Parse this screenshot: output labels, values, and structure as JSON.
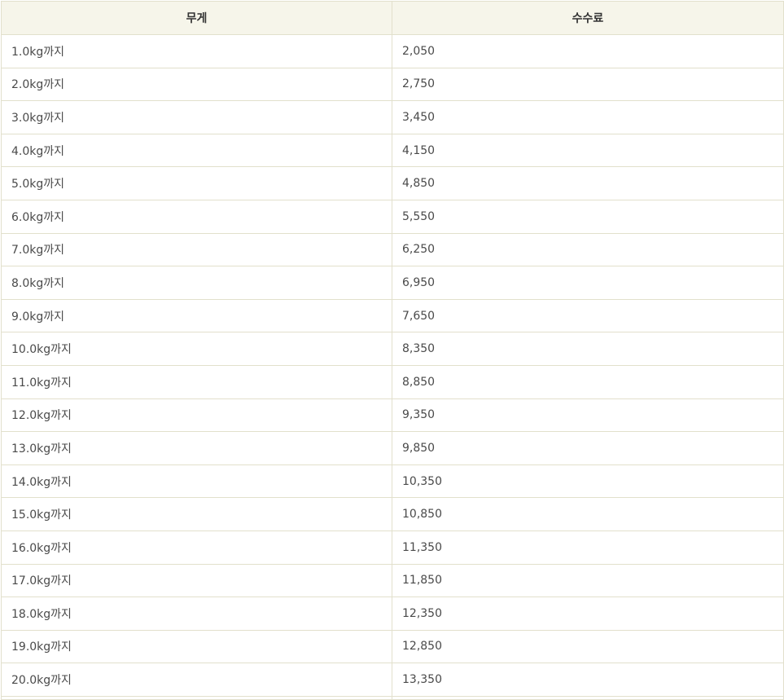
{
  "table": {
    "headers": {
      "weight": "무게",
      "fee": "수수료"
    },
    "rows": [
      {
        "weight": "1.0kg까지",
        "fee": "2,050"
      },
      {
        "weight": "2.0kg까지",
        "fee": "2,750"
      },
      {
        "weight": "3.0kg까지",
        "fee": "3,450"
      },
      {
        "weight": "4.0kg까지",
        "fee": "4,150"
      },
      {
        "weight": "5.0kg까지",
        "fee": "4,850"
      },
      {
        "weight": "6.0kg까지",
        "fee": "5,550"
      },
      {
        "weight": "7.0kg까지",
        "fee": "6,250"
      },
      {
        "weight": "8.0kg까지",
        "fee": "6,950"
      },
      {
        "weight": "9.0kg까지",
        "fee": "7,650"
      },
      {
        "weight": "10.0kg까지",
        "fee": "8,350"
      },
      {
        "weight": "11.0kg까지",
        "fee": "8,850"
      },
      {
        "weight": "12.0kg까지",
        "fee": "9,350"
      },
      {
        "weight": "13.0kg까지",
        "fee": "9,850"
      },
      {
        "weight": "14.0kg까지",
        "fee": "10,350"
      },
      {
        "weight": "15.0kg까지",
        "fee": "10,850"
      },
      {
        "weight": "16.0kg까지",
        "fee": "11,350"
      },
      {
        "weight": "17.0kg까지",
        "fee": "11,850"
      },
      {
        "weight": "18.0kg까지",
        "fee": "12,350"
      },
      {
        "weight": "19.0kg까지",
        "fee": "12,850"
      },
      {
        "weight": "20.0kg까지",
        "fee": "13,350"
      }
    ]
  },
  "colors": {
    "header_background": "#f6f5ea",
    "border": "#e2e0cc",
    "text": "#4a4a4a"
  }
}
